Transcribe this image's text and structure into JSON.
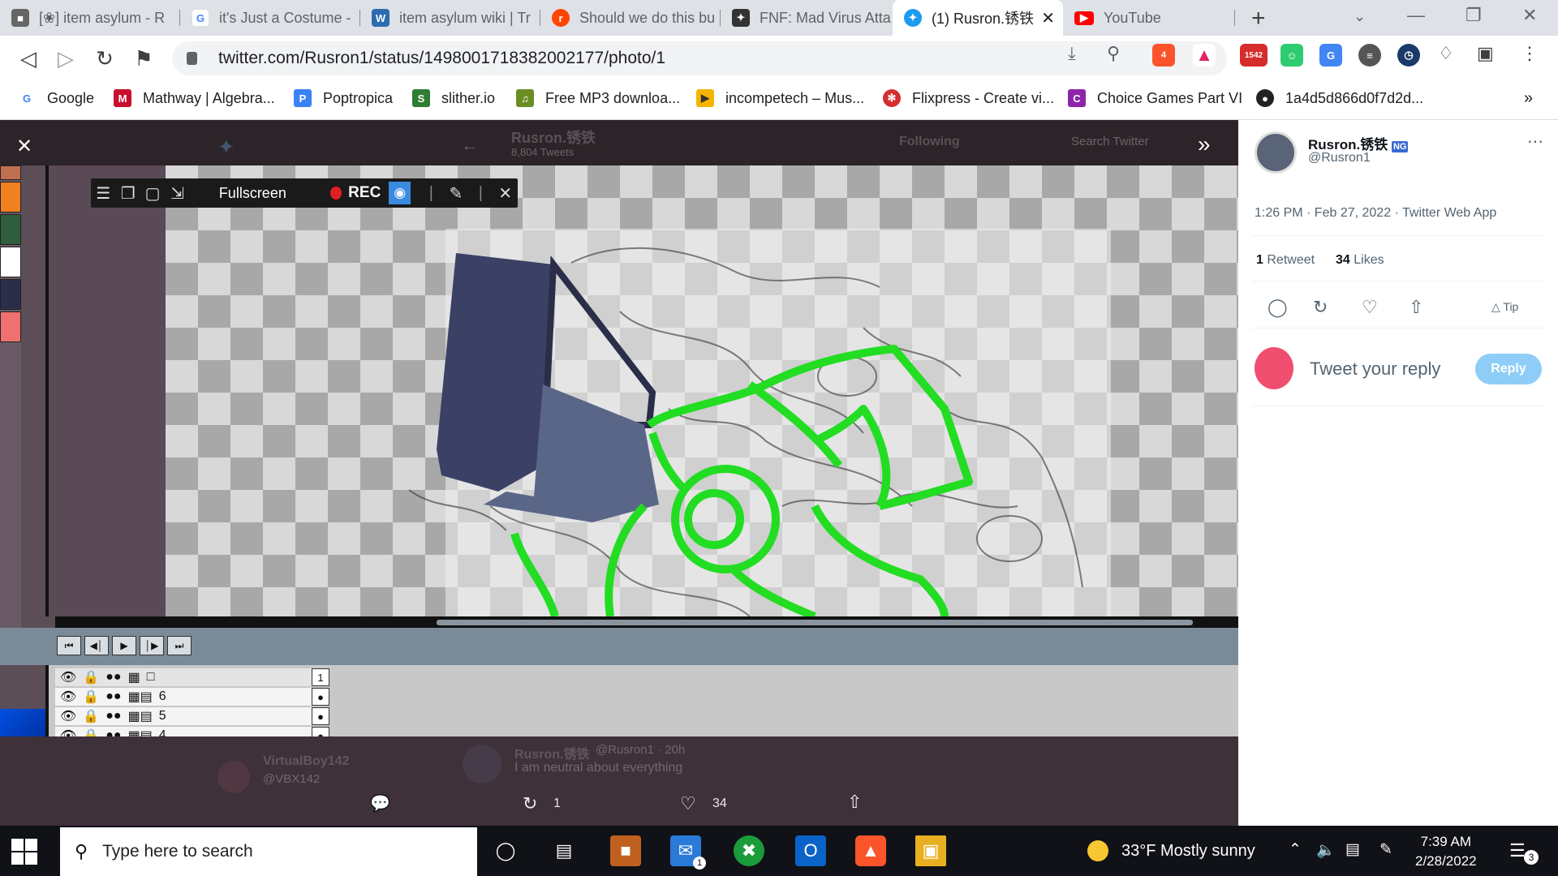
{
  "tabs": [
    {
      "title": "[❀] item asylum - R",
      "fav_color": "#555"
    },
    {
      "title": "it's Just a Costume -",
      "fav_color": "#4285f4"
    },
    {
      "title": "item asylum wiki | Tr",
      "fav_color": "#2b6cb0"
    },
    {
      "title": "Should we do this bu",
      "fav_color": "#ff4500"
    },
    {
      "title": "FNF: Mad Virus Atta",
      "fav_color": "#333"
    },
    {
      "title": "(1) Rusron.锈铁",
      "fav_color": "#1d9bf0"
    },
    {
      "title": "YouTube",
      "fav_color": "#ff0000"
    }
  ],
  "url": "twitter.com/Rusron1/status/1498001718382002177/photo/1",
  "brave_badge": "4",
  "ext_badge": "1542",
  "bookmarks": [
    {
      "label": "Google",
      "color": "#4285f4"
    },
    {
      "label": "Mathway | Algebra...",
      "color": "#c8102e"
    },
    {
      "label": "Poptropica",
      "color": "#3b82f6"
    },
    {
      "label": "slither.io",
      "color": "#2e7d32"
    },
    {
      "label": "Free MP3 downloa...",
      "color": "#6b8e23"
    },
    {
      "label": "incompetech – Mus...",
      "color": "#f5b400"
    },
    {
      "label": "Flixpress - Create vi...",
      "color": "#d32f2f"
    },
    {
      "label": "Choice Games Part VI",
      "color": "#8e24aa"
    },
    {
      "label": "1a4d5d866d0f7d2d...",
      "color": "#222"
    }
  ],
  "editor": {
    "recbar": {
      "fullscreen": "Fullscreen",
      "rec": "REC"
    },
    "layers": [
      {
        "name": "",
        "frame": "1"
      },
      {
        "name": "6",
        "frame": ""
      },
      {
        "name": "5",
        "frame": ""
      },
      {
        "name": "4",
        "frame": ""
      }
    ],
    "palette": [
      "#c07050",
      "#f08020",
      "#2e5e3e",
      "#ffffff",
      "#2a2e48",
      "#f07070"
    ]
  },
  "background_tweet": {
    "header_name": "Rusron.锈铁",
    "tweets_count": "8,804 Tweets",
    "following": "Following",
    "search": "Search Twitter",
    "reply_user": "VirtualBoy142",
    "reply_handle": "@VBX142",
    "reply_author": "Rusron.锈铁",
    "reply_author_handle": "@Rusron1 · 20h",
    "reply_text": "I am neutral about everything",
    "retweets": "1",
    "likes": "34"
  },
  "side": {
    "name": "Rusron.锈铁",
    "handle": "@Rusron1",
    "timestamp": "1:26 PM · Feb 27, 2022 · Twitter Web App",
    "retweets_num": "1",
    "retweets_label": "Retweet",
    "likes_num": "34",
    "likes_label": "Likes",
    "tip": "Tip",
    "reply_placeholder": "Tweet your reply",
    "reply_button": "Reply"
  },
  "taskbar": {
    "search_placeholder": "Type here to search",
    "weather": "33°F  Mostly sunny",
    "time": "7:39 AM",
    "date": "2/28/2022",
    "notif_count": "3",
    "mail_badge": "1"
  }
}
